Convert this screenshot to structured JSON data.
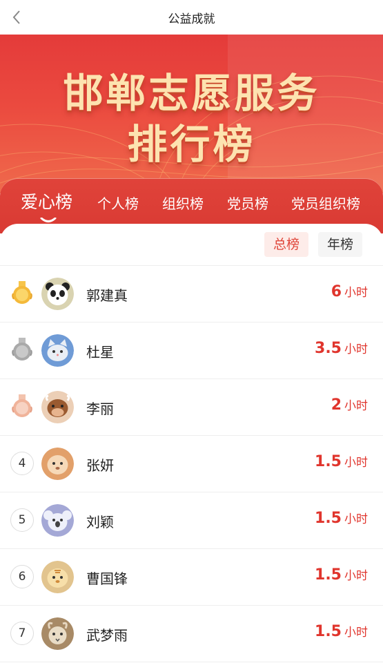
{
  "navbar": {
    "title": "公益成就",
    "back_icon": "chevron-left-icon"
  },
  "banner": {
    "line1": "邯郸志愿服务",
    "line2": "排行榜"
  },
  "tabs": [
    {
      "label": "爱心榜",
      "active": true
    },
    {
      "label": "个人榜",
      "active": false
    },
    {
      "label": "组织榜",
      "active": false
    },
    {
      "label": "党员榜",
      "active": false
    },
    {
      "label": "党员组织榜",
      "active": false
    }
  ],
  "filters": {
    "total": "总榜",
    "year": "年榜",
    "selected": "total"
  },
  "ranking": [
    {
      "rank": "1",
      "medal": "gold-medal-icon",
      "avatar": "panda-avatar-icon",
      "name": "郭建真",
      "hours": "6",
      "unit": "小时"
    },
    {
      "rank": "2",
      "medal": "silver-medal-icon",
      "avatar": "cat-avatar-icon",
      "name": "杜星",
      "hours": "3.5",
      "unit": "小时"
    },
    {
      "rank": "3",
      "medal": "bronze-medal-icon",
      "avatar": "ox-avatar-icon",
      "name": "李丽",
      "hours": "2",
      "unit": "小时"
    },
    {
      "rank": "4",
      "medal": "",
      "avatar": "dog-avatar-icon",
      "name": "张妍",
      "hours": "1.5",
      "unit": "小时"
    },
    {
      "rank": "5",
      "medal": "",
      "avatar": "koala-avatar-icon",
      "name": "刘颖",
      "hours": "1.5",
      "unit": "小时"
    },
    {
      "rank": "6",
      "medal": "",
      "avatar": "tiger-avatar-icon",
      "name": "曹国锋",
      "hours": "1.5",
      "unit": "小时"
    },
    {
      "rank": "7",
      "medal": "",
      "avatar": "goat-avatar-icon",
      "name": "武梦雨",
      "hours": "1.5",
      "unit": "小时"
    }
  ],
  "colors": {
    "accent": "#e0352d",
    "banner_top": "#e43b3a",
    "banner_title": "#fde3b0",
    "gold": "#f4b93a",
    "silver": "#a9a9a9",
    "bronze": "#f0b39a"
  }
}
